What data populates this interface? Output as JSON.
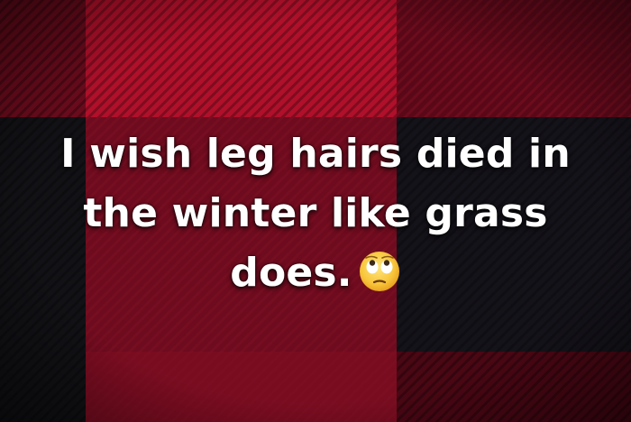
{
  "caption": {
    "line1": "I wish leg hairs died in",
    "line2": "the winter like grass",
    "line3": "does."
  },
  "emoji": {
    "name": "face-with-rolling-eyes-icon"
  },
  "colors": {
    "plaid_red": "#b0102a",
    "plaid_dark_red": "#5a0818",
    "plaid_black": "#111114",
    "text": "#ffffff"
  }
}
